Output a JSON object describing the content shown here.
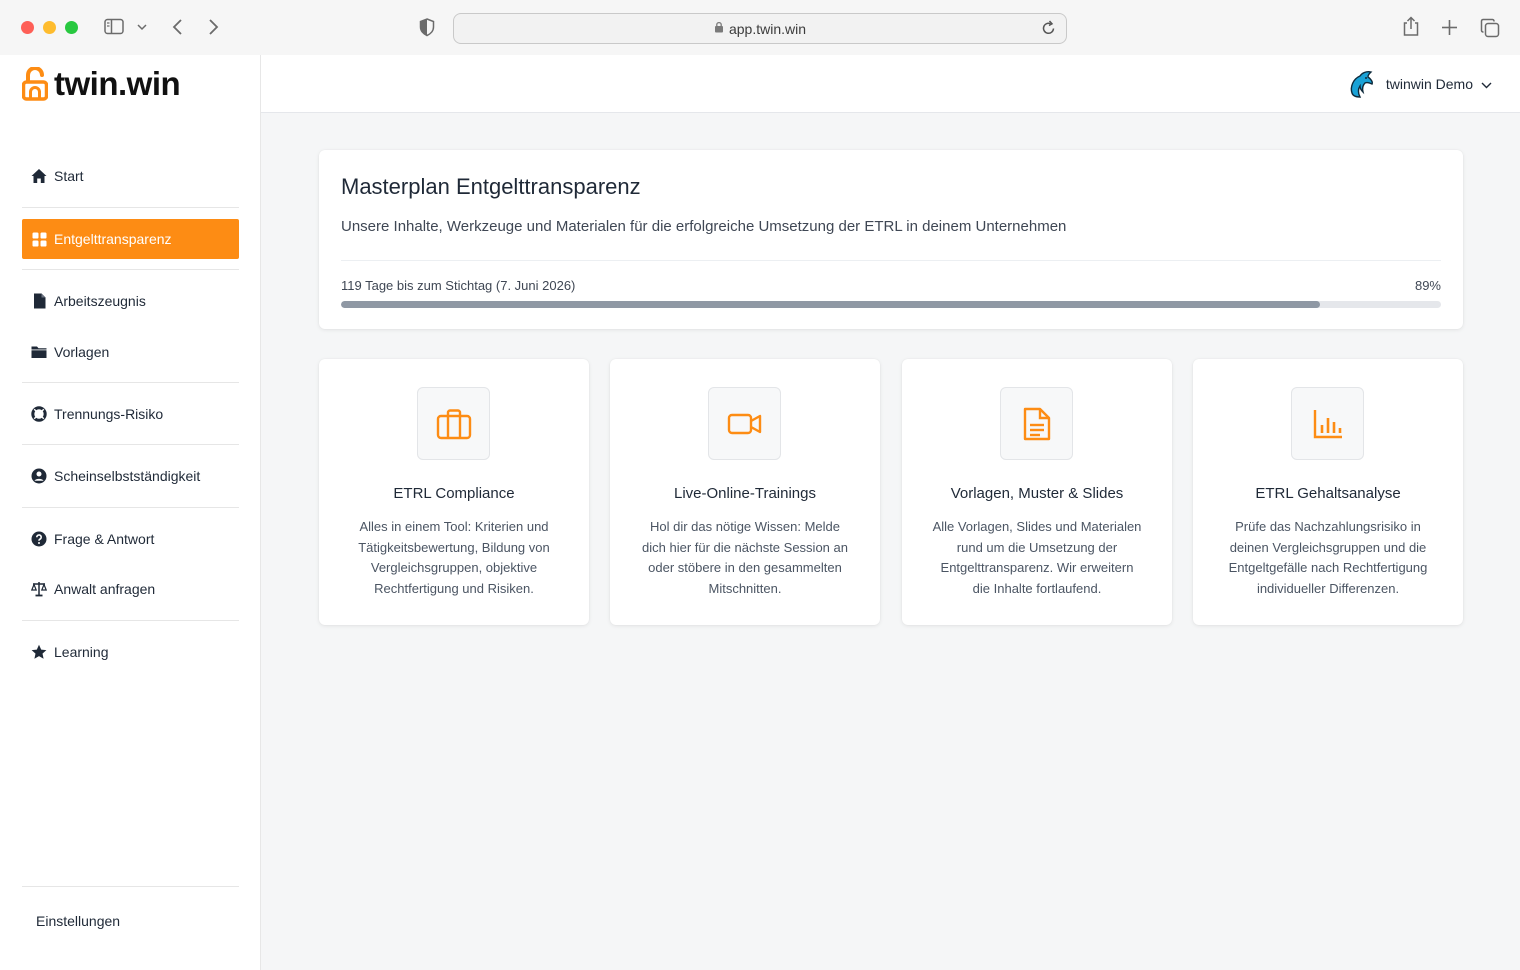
{
  "browser": {
    "url": "app.twin.win"
  },
  "brand": {
    "name": "twin.win",
    "accent": "#fd8c14"
  },
  "sidebar": {
    "items": [
      {
        "label": "Start",
        "icon": "home-icon"
      },
      {
        "label": "Entgelttransparenz",
        "icon": "grid-icon",
        "active": true
      },
      {
        "label": "Arbeitszeugnis",
        "icon": "document-icon"
      },
      {
        "label": "Vorlagen",
        "icon": "folder-icon"
      },
      {
        "label": "Trennungs-Risiko",
        "icon": "lifebuoy-icon"
      },
      {
        "label": "Scheinselbstständigkeit",
        "icon": "user-circle-icon"
      },
      {
        "label": "Frage & Antwort",
        "icon": "question-icon"
      },
      {
        "label": "Anwalt anfragen",
        "icon": "scale-icon"
      },
      {
        "label": "Learning",
        "icon": "star-icon"
      }
    ],
    "settings_label": "Einstellungen"
  },
  "header": {
    "user_name": "twinwin Demo"
  },
  "hero": {
    "title": "Masterplan Entgelttransparenz",
    "subtitle": "Unsere Inhalte, Werkzeuge und Materialen für die erfolgreiche Umsetzung der ETRL in deinem Unternehmen",
    "deadline_text": "119 Tage bis zum Stichtag (7. Juni 2026)",
    "progress_label": "89%",
    "progress_value": 0.89
  },
  "cards": [
    {
      "title": "ETRL Compliance",
      "description": "Alles in einem Tool: Kriterien und Tätigkeitsbewertung, Bildung von Vergleichsgruppen, objektive Rechtfertigung und Risiken.",
      "icon": "briefcase-icon"
    },
    {
      "title": "Live-Online-Trainings",
      "description": "Hol dir das nötige Wissen: Melde dich hier für die nächste Session an oder stöbere in den gesammelten Mitschnitten.",
      "icon": "video-camera-icon"
    },
    {
      "title": "Vorlagen, Muster & Slides",
      "description": "Alle Vorlagen, Slides und Materialen rund um die Umsetzung der Entgelttransparenz. Wir erweitern die Inhalte fortlaufend.",
      "icon": "document-text-icon"
    },
    {
      "title": "ETRL Gehaltsanalyse",
      "description": "Prüfe das Nachzahlungsrisiko in deinen Vergleichsgruppen und die Entgeltgefälle nach Rechtfertigung individueller Differenzen.",
      "icon": "bar-chart-icon"
    }
  ]
}
